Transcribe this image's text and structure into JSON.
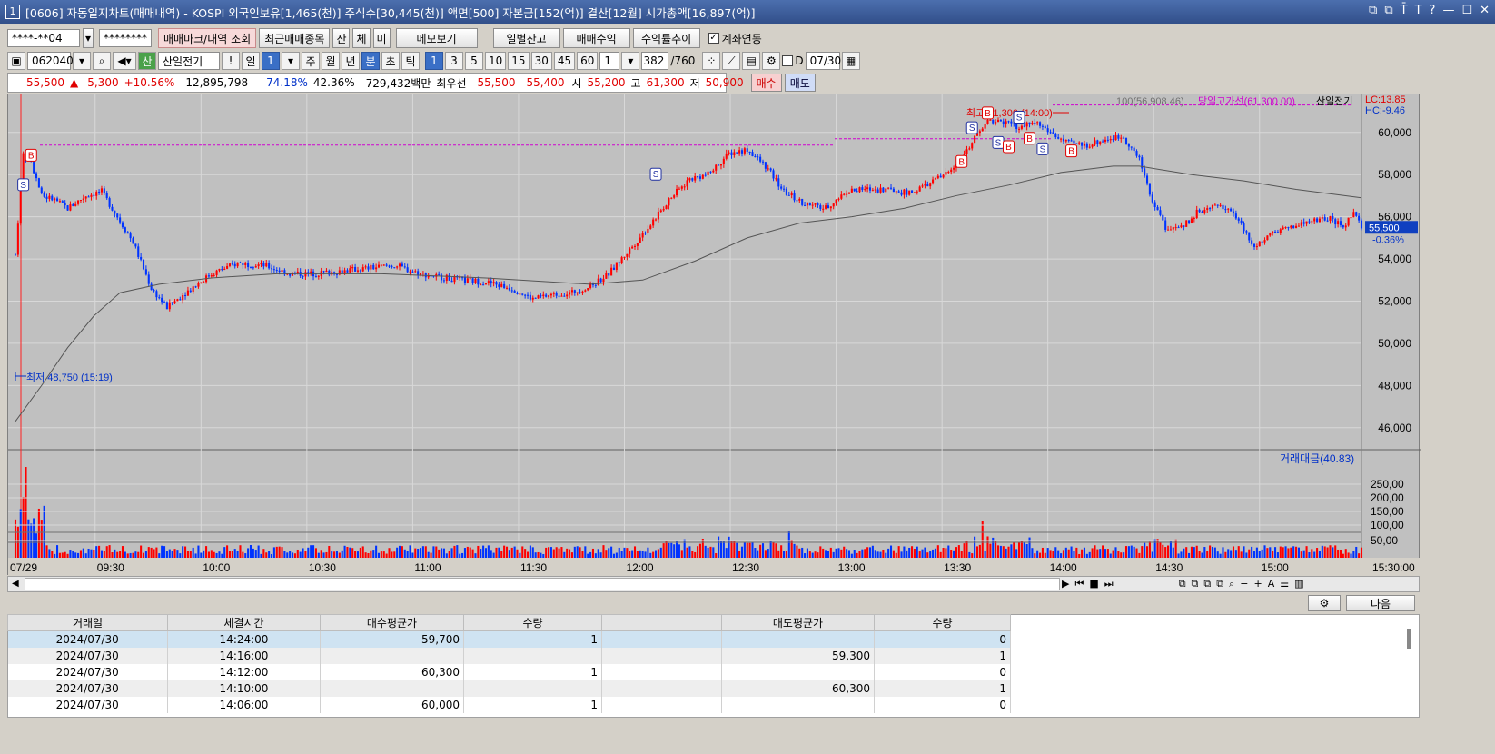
{
  "window": {
    "num": "1",
    "title": "[0606] 자동일지차트(매매내역) - KOSPI 외국인보유[1,465(천)] 주식수[30,445(천)] 액면[500] 자본금[152(억)] 결산[12월] 시가총액[16,897(억)]",
    "icons": [
      "⧉",
      "⧉",
      "T̄",
      "T",
      "?",
      "—",
      "☐",
      "✕"
    ]
  },
  "toolbar1": {
    "account": "****-**04",
    "password": "********",
    "trade_mark_btn": "매매마크/내역 조회",
    "recent_btn": "최근매매종목",
    "btn_jan": "잔",
    "btn_che": "체",
    "btn_mi": "미",
    "memo_btn": "메모보기",
    "daily_btn": "일별잔고",
    "profit_btn": "매매수익",
    "profit_trend_btn": "수익률추이",
    "account_link": "계좌연동",
    "account_link_checked": true
  },
  "toolbar2": {
    "code": "062040",
    "stock_name": "산일전기",
    "period_il": "일",
    "period_val": "1",
    "period_ju": "주",
    "period_wol": "월",
    "period_nyeon": "년",
    "period_bun": "분",
    "period_cho": "초",
    "period_tik": "틱",
    "intervals": [
      "1",
      "3",
      "5",
      "10",
      "15",
      "30",
      "45",
      "60"
    ],
    "interval_selected": "1",
    "n_val": "1",
    "count": "382",
    "count_total": "/760",
    "date_label": "D",
    "date": "07/30"
  },
  "pricebar": {
    "price": "55,500",
    "arrow": "▲",
    "change": "5,300",
    "rate": "+10.56%",
    "volume": "12,895,798",
    "ratio1": "74.18%",
    "ratio2": "42.36%",
    "amount": "729,432백만",
    "best_label": "최우선",
    "ask": "55,500",
    "bid": "55,400",
    "open_label": "시",
    "open": "55,200",
    "high_label": "고",
    "high": "61,300",
    "low_label": "저",
    "low": "50,900",
    "buy_btn": "매수",
    "sell_btn": "매도"
  },
  "chart_data": {
    "type": "candlestick",
    "x_ticks": [
      "07/29",
      "09:30",
      "10:00",
      "10:30",
      "11:00",
      "11:30",
      "12:00",
      "12:30",
      "13:00",
      "13:30",
      "14:00",
      "14:30",
      "15:00",
      "15:30:00"
    ],
    "y_ticks": [
      "60,000",
      "58,000",
      "56,000",
      "54,000",
      "52,000",
      "50,000",
      "48,000",
      "46,000"
    ],
    "ylim": [
      45000,
      61800
    ],
    "vol_ticks": [
      "250,00",
      "200,00",
      "150,00",
      "100,00",
      "50,00"
    ],
    "legend_ma": "100(56,908.46)",
    "legend_high_line": "당일고가선(61,300.00)",
    "legend_name": "산일전기",
    "lc": "LC:13.85",
    "hc": "HC:-9.46",
    "current_price_tag": "55,500",
    "current_pct": "-0.36%",
    "high_annot": "최고 61,300 (14:00)",
    "low_annot": "최저 48,750 (15:19)",
    "volume_legend": "거래대금(40.83)",
    "close_path": [
      [
        0,
        54200
      ],
      [
        3,
        59000
      ],
      [
        6,
        58600
      ],
      [
        10,
        57000
      ],
      [
        15,
        56800
      ],
      [
        20,
        56400
      ],
      [
        27,
        57000
      ],
      [
        33,
        57200
      ],
      [
        38,
        56200
      ],
      [
        45,
        54800
      ],
      [
        52,
        52600
      ],
      [
        58,
        51700
      ],
      [
        65,
        52400
      ],
      [
        75,
        53300
      ],
      [
        85,
        53800
      ],
      [
        95,
        53700
      ],
      [
        105,
        53300
      ],
      [
        115,
        53300
      ],
      [
        130,
        53500
      ],
      [
        145,
        53700
      ],
      [
        155,
        53300
      ],
      [
        170,
        53000
      ],
      [
        180,
        52900
      ],
      [
        190,
        52600
      ],
      [
        198,
        52100
      ],
      [
        205,
        52300
      ],
      [
        213,
        52400
      ],
      [
        220,
        52700
      ],
      [
        227,
        53300
      ],
      [
        234,
        54300
      ],
      [
        242,
        55500
      ],
      [
        250,
        56800
      ],
      [
        258,
        57800
      ],
      [
        265,
        58000
      ],
      [
        273,
        59000
      ],
      [
        280,
        59200
      ],
      [
        287,
        58400
      ],
      [
        294,
        57200
      ],
      [
        302,
        56600
      ],
      [
        310,
        56400
      ],
      [
        318,
        57200
      ],
      [
        326,
        57300
      ],
      [
        334,
        57300
      ],
      [
        342,
        57100
      ],
      [
        350,
        57600
      ],
      [
        358,
        58200
      ],
      [
        366,
        59500
      ],
      [
        372,
        60600
      ],
      [
        378,
        60500
      ],
      [
        384,
        60200
      ],
      [
        390,
        60500
      ],
      [
        396,
        60000
      ],
      [
        402,
        59500
      ],
      [
        410,
        59400
      ],
      [
        418,
        59700
      ],
      [
        424,
        59800
      ],
      [
        430,
        58700
      ],
      [
        435,
        56800
      ],
      [
        440,
        55500
      ],
      [
        446,
        55500
      ],
      [
        452,
        56200
      ],
      [
        458,
        56500
      ],
      [
        463,
        56500
      ],
      [
        468,
        55800
      ],
      [
        474,
        54500
      ],
      [
        480,
        55300
      ],
      [
        488,
        55500
      ],
      [
        496,
        55800
      ],
      [
        503,
        55900
      ],
      [
        508,
        55500
      ],
      [
        512,
        56200
      ],
      [
        515,
        55500
      ]
    ],
    "ma_path": [
      [
        0,
        46300
      ],
      [
        10,
        48000
      ],
      [
        20,
        49800
      ],
      [
        30,
        51300
      ],
      [
        40,
        52400
      ],
      [
        55,
        52800
      ],
      [
        75,
        53100
      ],
      [
        100,
        53300
      ],
      [
        140,
        53300
      ],
      [
        180,
        53100
      ],
      [
        220,
        52800
      ],
      [
        240,
        53000
      ],
      [
        260,
        53900
      ],
      [
        280,
        55000
      ],
      [
        300,
        55700
      ],
      [
        320,
        56000
      ],
      [
        340,
        56400
      ],
      [
        360,
        57000
      ],
      [
        380,
        57500
      ],
      [
        400,
        58100
      ],
      [
        420,
        58400
      ],
      [
        430,
        58400
      ],
      [
        450,
        58000
      ],
      [
        470,
        57700
      ],
      [
        490,
        57300
      ],
      [
        515,
        56900
      ]
    ],
    "open": 55200,
    "high": 61300,
    "low": 50900
  },
  "tablebar": {
    "settings_btn": "⚙",
    "next_btn": "다음"
  },
  "table": {
    "headers": [
      "거래일",
      "체결시간",
      "매수평균가",
      "수량",
      "",
      "매도평균가",
      "수량"
    ],
    "rows": [
      {
        "date": "2024/07/30",
        "time": "14:24:00",
        "buy_avg": "59,700",
        "buy_qty": "1",
        "sell_avg": "",
        "sell_qty": "0"
      },
      {
        "date": "2024/07/30",
        "time": "14:16:00",
        "buy_avg": "",
        "buy_qty": "",
        "sell_avg": "59,300",
        "sell_qty": "1"
      },
      {
        "date": "2024/07/30",
        "time": "14:12:00",
        "buy_avg": "60,300",
        "buy_qty": "1",
        "sell_avg": "",
        "sell_qty": "0"
      },
      {
        "date": "2024/07/30",
        "time": "14:10:00",
        "buy_avg": "",
        "buy_qty": "",
        "sell_avg": "60,300",
        "sell_qty": "1"
      },
      {
        "date": "2024/07/30",
        "time": "14:06:00",
        "buy_avg": "60,000",
        "buy_qty": "1",
        "sell_avg": "",
        "sell_qty": "0"
      }
    ]
  }
}
